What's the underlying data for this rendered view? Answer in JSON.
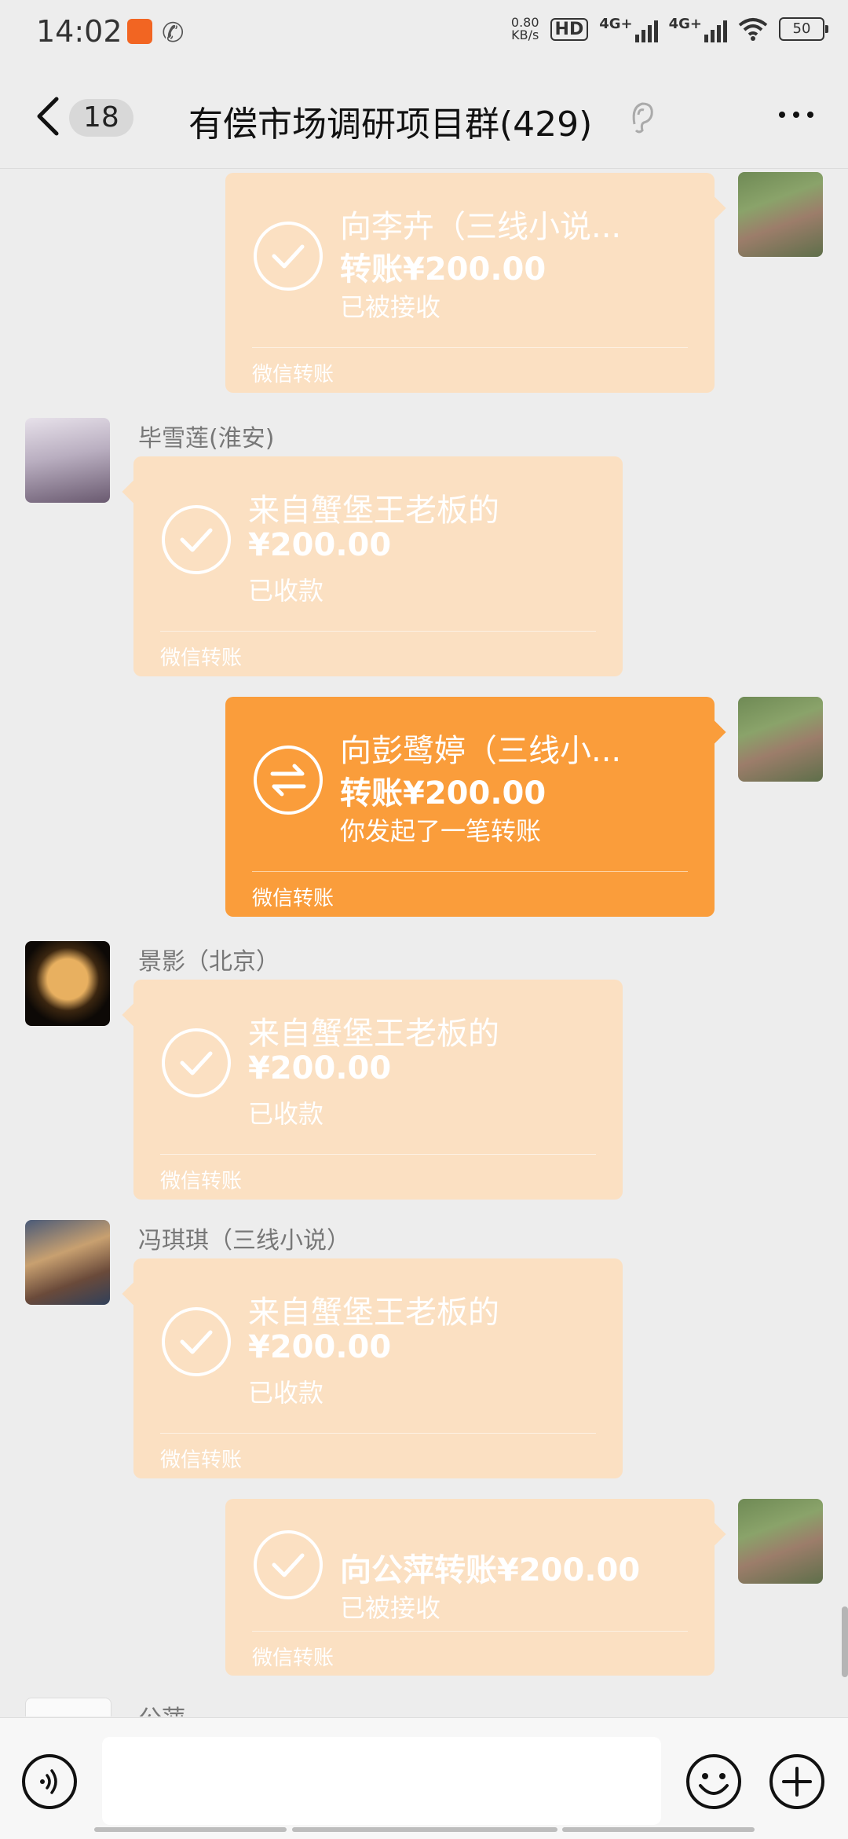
{
  "status_bar": {
    "time": "14:02",
    "net_speed": "0.80",
    "net_unit": "KB/s",
    "hd_label": "HD",
    "sig1_label": "4G+",
    "sig2_label": "4G+",
    "battery": "50"
  },
  "nav": {
    "unread_count": "18",
    "title": "有偿市场调研项目群(429)"
  },
  "messages": [
    {
      "direction": "out",
      "state": "received",
      "line1": "向李卉（三线小说...",
      "line2": "转账¥200.00",
      "line3": "已被接收",
      "footer": "微信转账"
    },
    {
      "direction": "in",
      "sender": "毕雪莲(淮安)",
      "state": "received",
      "line1": "来自蟹堡王老板的",
      "line2": "¥200.00",
      "line3": "已收款",
      "footer": "微信转账"
    },
    {
      "direction": "out",
      "state": "pending",
      "line1": "向彭鹭婷（三线小...",
      "line2": "转账¥200.00",
      "line3": "你发起了一笔转账",
      "footer": "微信转账"
    },
    {
      "direction": "in",
      "sender": "景影（北京）",
      "state": "received",
      "line1": "来自蟹堡王老板的",
      "line2": "¥200.00",
      "line3": "已收款",
      "footer": "微信转账"
    },
    {
      "direction": "in",
      "sender": "冯琪琪（三线小说）",
      "state": "received",
      "line1": "来自蟹堡王老板的",
      "line2": "¥200.00",
      "line3": "已收款",
      "footer": "微信转账"
    },
    {
      "direction": "out",
      "state": "received",
      "line1": "向公萍转账¥200.00",
      "line3": "已被接收",
      "footer": "微信转账"
    }
  ],
  "partial_sender": "公萍",
  "input": {
    "placeholder": ""
  },
  "colors": {
    "bubble_faded": "#fbe0c2",
    "bubble_active": "#fa9d3b",
    "background": "#ededed"
  }
}
